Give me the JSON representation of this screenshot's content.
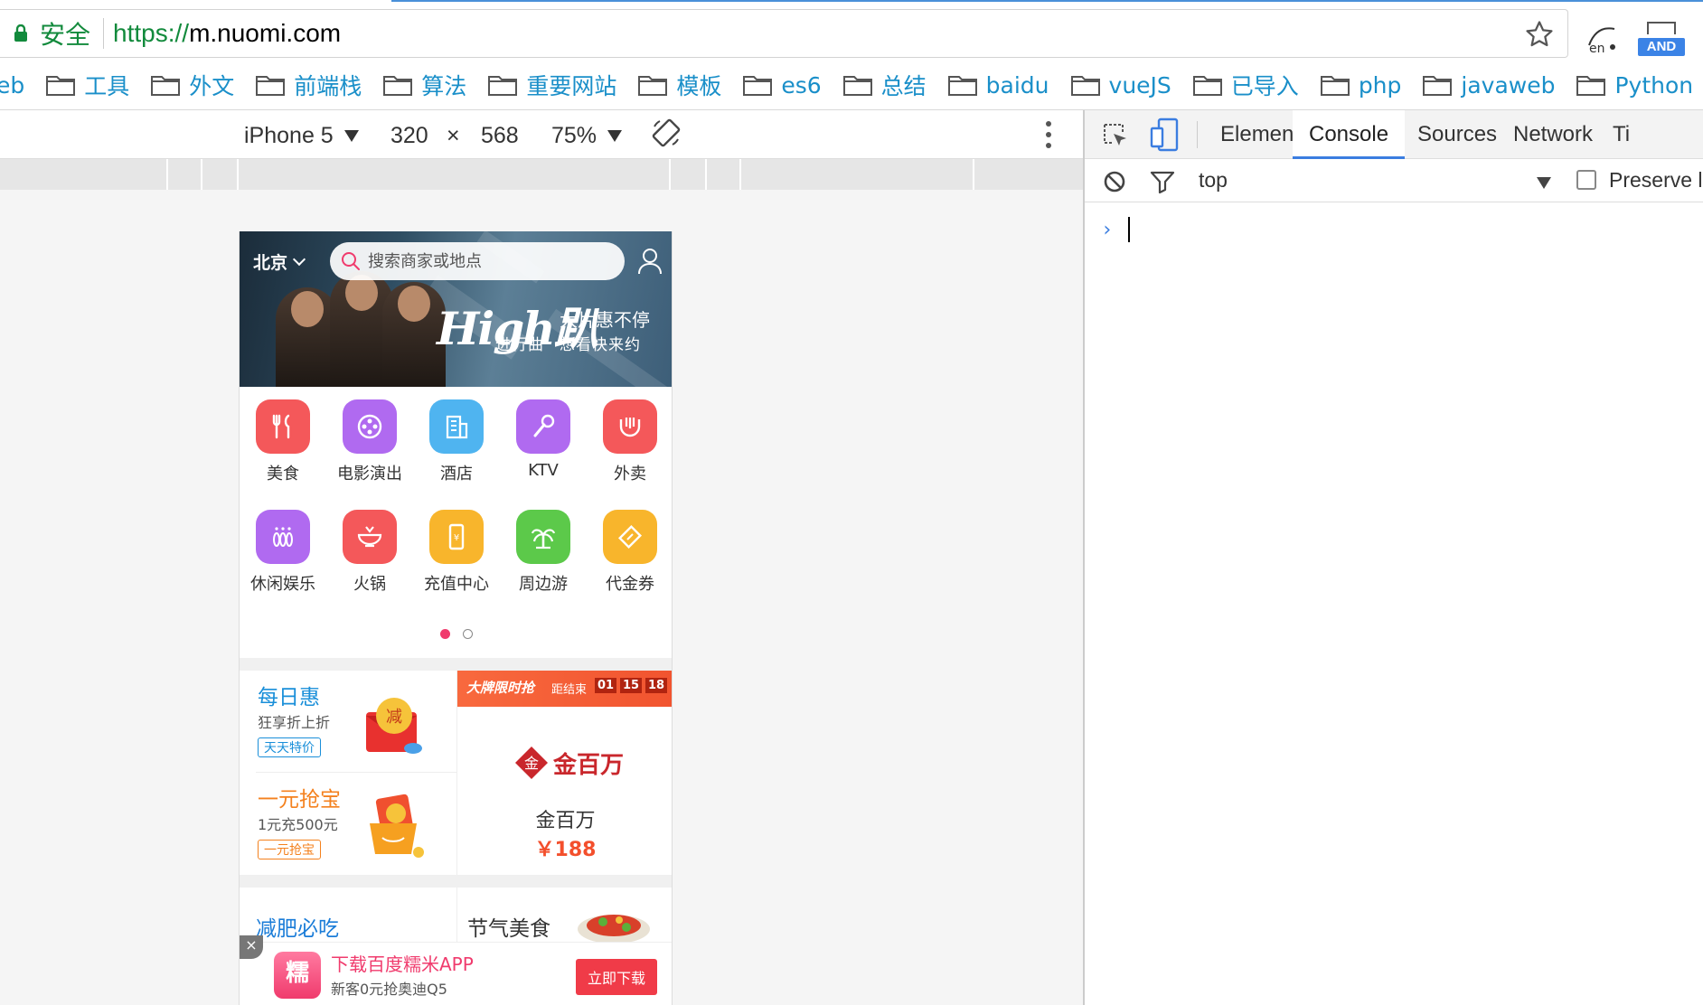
{
  "browser": {
    "secure_label": "安全",
    "url_scheme": "https://",
    "url_host": "m.nuomi.com",
    "extensions": {
      "en_label": "en",
      "and_label": "AND"
    },
    "bookmarks": [
      "eb",
      "工具",
      "外文",
      "前端栈",
      "算法",
      "重要网站",
      "模板",
      "es6",
      "总结",
      "baidu",
      "vueJS",
      "已导入",
      "php",
      "javaweb",
      "Python"
    ]
  },
  "device_toolbar": {
    "device": "iPhone 5",
    "width": "320",
    "times": "×",
    "height": "568",
    "zoom": "75%"
  },
  "mobile": {
    "city": "北京",
    "search_placeholder": "搜索商家或地点",
    "banner": {
      "title": "High趴",
      "line1": "大片惠不停",
      "line2a": "进行曲",
      "line2b": "想看快来约"
    },
    "categories": [
      {
        "label": "美食",
        "color": "#f4585a",
        "icon": "fork-knife-icon"
      },
      {
        "label": "电影演出",
        "color": "#b06af0",
        "icon": "film-reel-icon"
      },
      {
        "label": "酒店",
        "color": "#4fb4f0",
        "icon": "hotel-icon"
      },
      {
        "label": "KTV",
        "color": "#b06af0",
        "icon": "microphone-icon"
      },
      {
        "label": "外卖",
        "color": "#f4585a",
        "icon": "takeout-icon"
      },
      {
        "label": "休闲娱乐",
        "color": "#b06af0",
        "icon": "bowling-icon"
      },
      {
        "label": "火锅",
        "color": "#f4585a",
        "icon": "hotpot-icon"
      },
      {
        "label": "充值中心",
        "color": "#f8b52c",
        "icon": "phone-recharge-icon"
      },
      {
        "label": "周边游",
        "color": "#5cc94a",
        "icon": "palm-tree-icon"
      },
      {
        "label": "代金券",
        "color": "#f8b52c",
        "icon": "coupon-icon"
      }
    ],
    "promo": {
      "daily_title": "每日惠",
      "daily_sub": "狂享折上折",
      "daily_tag": "天天特价",
      "daily_badge": "减",
      "one_title": "一元抢宝",
      "one_sub": "1元充500元",
      "one_tag": "一元抢宝",
      "flash_title": "大牌限时抢",
      "flash_end": "距结束",
      "countdown": [
        "01",
        "15",
        "18"
      ],
      "brand_logo": "金百万",
      "brand_name": "金百万",
      "brand_price": "￥188"
    },
    "section_left": "减肥必吃",
    "section_right": "节气美食",
    "download": {
      "close": "×",
      "logo": "糯",
      "title": "下载百度糯米APP",
      "sub": "新客0元抢奥迪Q5",
      "button": "立即下载"
    }
  },
  "devtools": {
    "tabs": [
      "Elements",
      "Console",
      "Sources",
      "Network",
      "Ti"
    ],
    "active_tab": "Console",
    "context": "top",
    "preserve_label": "Preserve lo",
    "prompt": "›"
  }
}
